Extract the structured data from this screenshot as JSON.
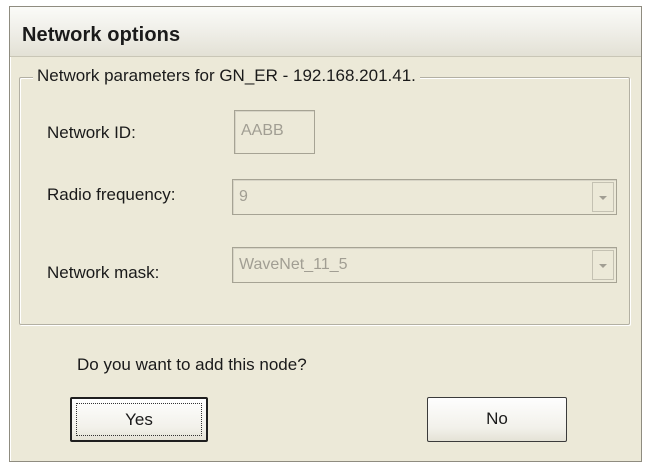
{
  "dialog": {
    "title": "Network options"
  },
  "group": {
    "legend": "Network parameters for GN_ER - 192.168.201.41."
  },
  "fields": {
    "network_id": {
      "label": "Network ID:",
      "value": "AABB"
    },
    "radio_frequency": {
      "label": "Radio frequency:",
      "value": "9"
    },
    "network_mask": {
      "label": "Network mask:",
      "value": "WaveNet_11_5"
    }
  },
  "prompt": {
    "question": "Do you want to add this node?"
  },
  "buttons": {
    "yes_label": "Yes",
    "no_label": "No"
  },
  "icons": {
    "dropdown": "chevron-down-icon"
  }
}
